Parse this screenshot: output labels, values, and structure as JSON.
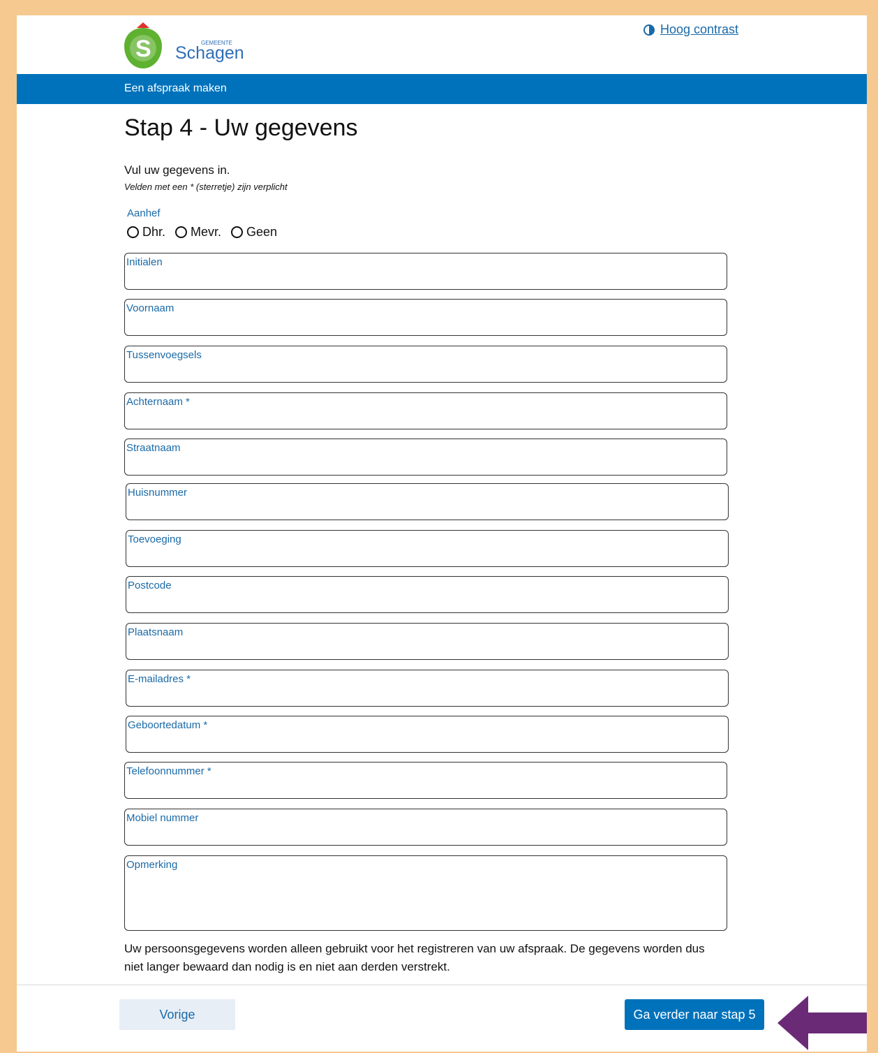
{
  "header": {
    "logo_small": "GEMEENTE",
    "logo_name": "Schagen",
    "logo_letter": "S",
    "contrast_link": "Hoog contrast"
  },
  "nav": {
    "title": "Een afspraak maken"
  },
  "main": {
    "heading": "Stap 4 - Uw gegevens",
    "intro": "Vul uw gegevens in.",
    "required_note": "Velden met een * (sterretje) zijn verplicht",
    "salutation": {
      "label": "Aanhef",
      "options": [
        "Dhr.",
        "Mevr.",
        "Geen"
      ]
    },
    "fields": [
      "Initialen",
      "Voornaam",
      "Tussenvoegsels",
      "Achternaam *",
      "Straatnaam",
      "Huisnummer",
      "Toevoeging",
      "Postcode",
      "Plaatsnaam",
      "E-mailadres *",
      "Geboortedatum *",
      "Telefoonnummer *",
      "Mobiel nummer",
      "Opmerking"
    ],
    "privacy": "Uw persoonsgegevens worden alleen gebruikt voor het registreren van uw afspraak. De gegevens worden dus niet langer bewaard dan nodig is en niet aan derden verstrekt."
  },
  "footer": {
    "prev_label": "Vorige",
    "next_label": "Ga verder naar stap 5"
  },
  "colors": {
    "brand_blue": "#0072bb",
    "label_blue": "#1a6aa8",
    "logo_green": "#5fb130",
    "logo_red": "#e2312b",
    "arrow_purple": "#6b2a76",
    "page_border": "#f5c98f"
  }
}
